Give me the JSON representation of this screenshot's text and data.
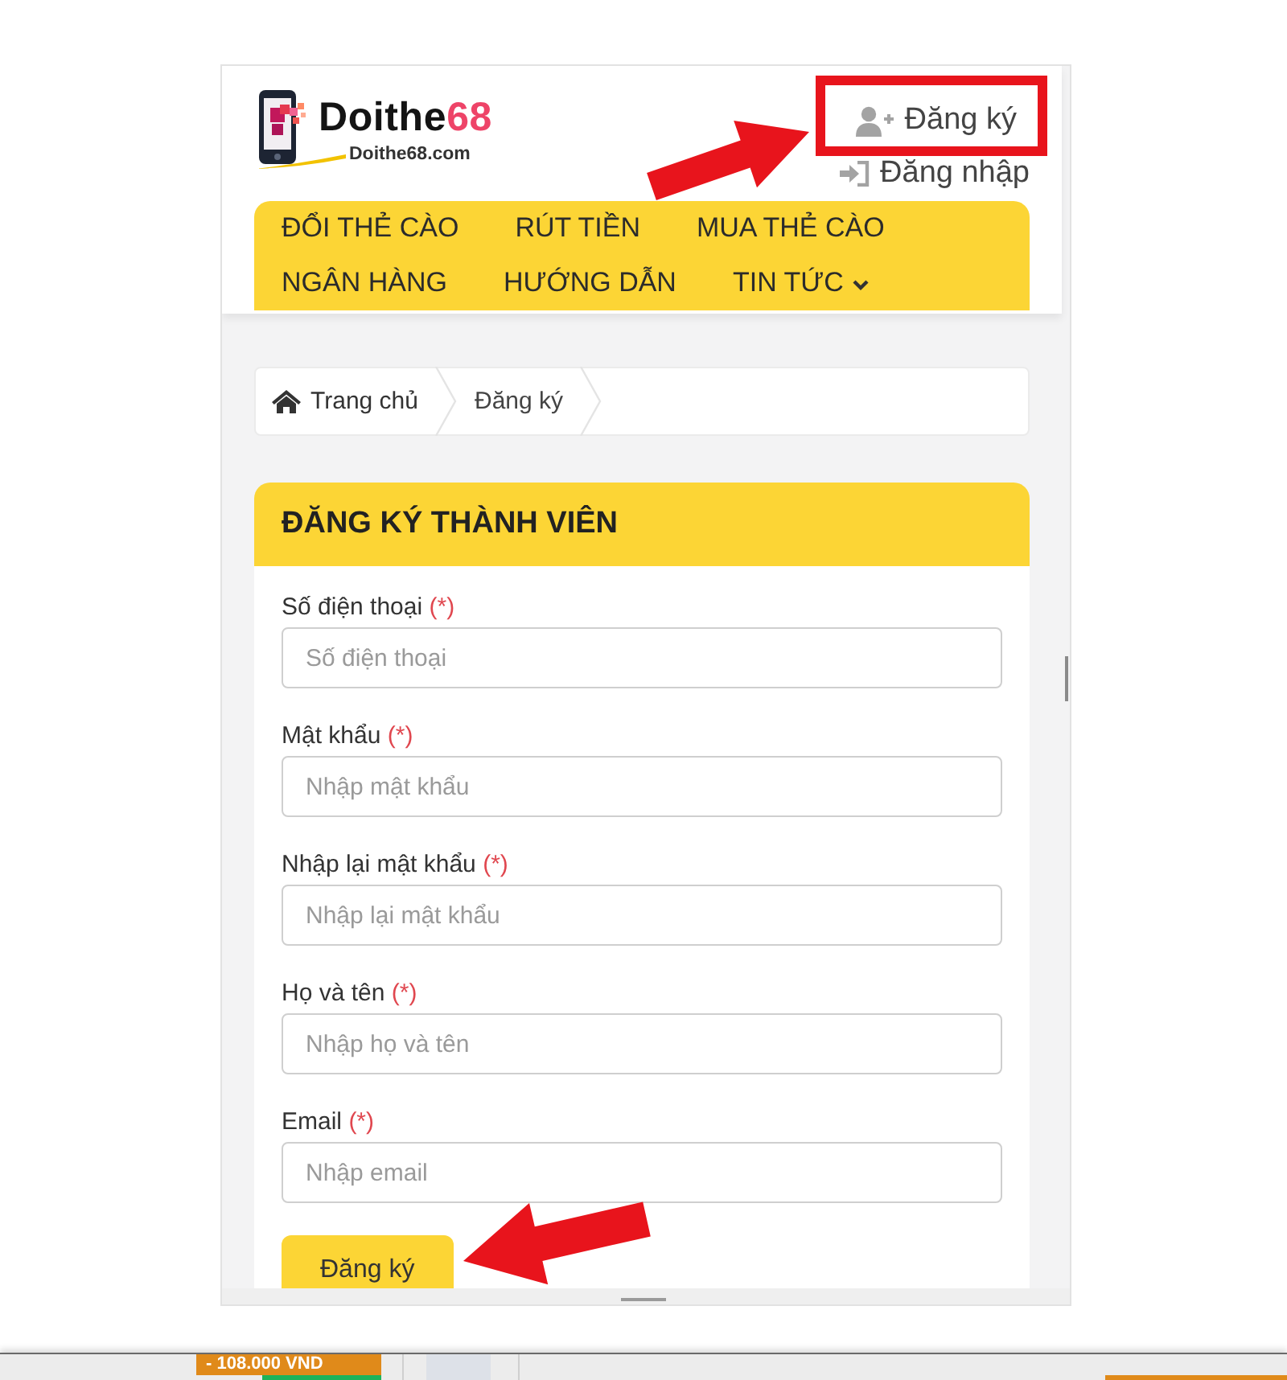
{
  "header": {
    "logo": {
      "text": "Doithe",
      "accent": "68",
      "domain": "Doithe68.com"
    },
    "account_links": [
      {
        "kind": "register",
        "label": "Đăng ký",
        "highlighted": true
      },
      {
        "kind": "login",
        "label": "Đăng nhập",
        "highlighted": false
      }
    ]
  },
  "nav": {
    "items": [
      {
        "label": "ĐỔI THẺ CÀO",
        "has_dropdown": false
      },
      {
        "label": "RÚT TIỀN",
        "has_dropdown": false
      },
      {
        "label": "MUA THẺ CÀO",
        "has_dropdown": false
      },
      {
        "label": "NGÂN HÀNG",
        "has_dropdown": false
      },
      {
        "label": "HƯỚNG DẪN",
        "has_dropdown": false
      },
      {
        "label": "TIN TỨC",
        "has_dropdown": true
      }
    ]
  },
  "breadcrumb": [
    {
      "kind": "home",
      "label": "Trang chủ"
    },
    {
      "kind": "current",
      "label": "Đăng ký"
    }
  ],
  "form": {
    "title": "ĐĂNG KÝ THÀNH VIÊN",
    "fields": [
      {
        "label": "Số điện thoại",
        "required_mark": "(*)",
        "placeholder": "Số điện thoại"
      },
      {
        "label": "Mật khẩu",
        "required_mark": "(*)",
        "placeholder": "Nhập mật khẩu"
      },
      {
        "label": "Nhập lại mật khẩu",
        "required_mark": "(*)",
        "placeholder": "Nhập lại mật khẩu"
      },
      {
        "label": "Họ và tên",
        "required_mark": "(*)",
        "placeholder": "Nhập họ và tên"
      },
      {
        "label": "Email",
        "required_mark": "(*)",
        "placeholder": "Nhập email"
      }
    ],
    "submit": {
      "label": "Đăng ký",
      "pointed_at": true
    }
  },
  "background_app": {
    "price_tag": "- 108.000 VND"
  }
}
